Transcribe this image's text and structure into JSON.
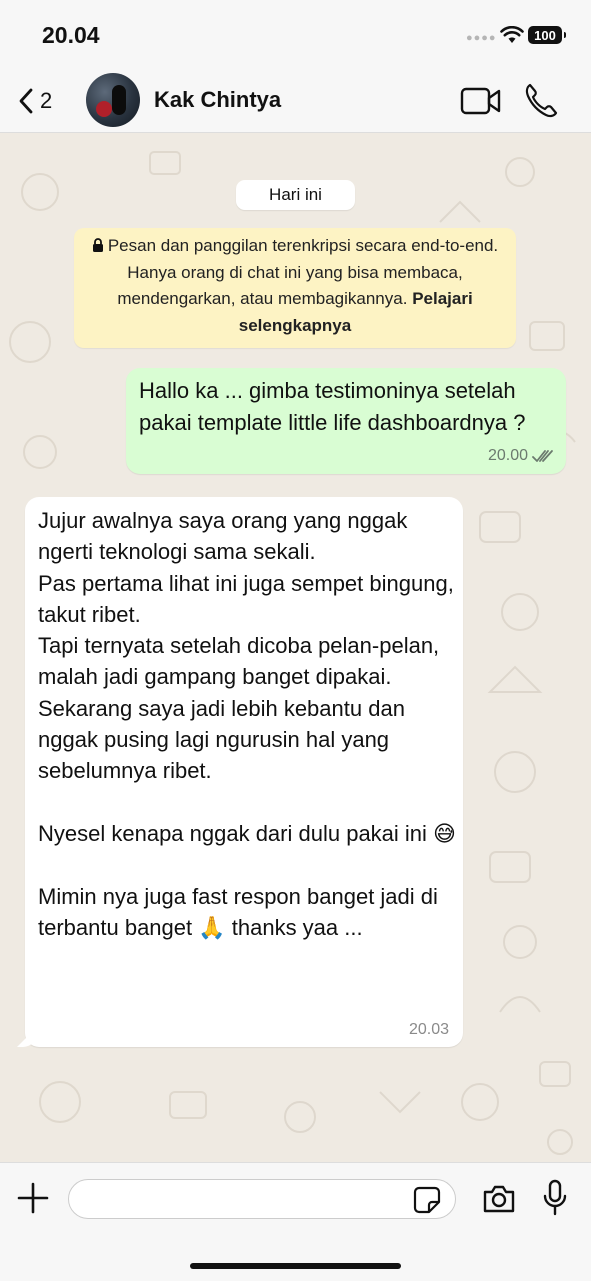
{
  "status_bar": {
    "time": "20.04",
    "battery": "100"
  },
  "header": {
    "back_count": "2",
    "contact_name": "Kak Chintya"
  },
  "chat": {
    "date_chip": "Hari ini",
    "encryption_notice": {
      "text": "Pesan dan panggilan terenkripsi secara end-to-end. Hanya orang di chat ini yang bisa membaca, mendengarkan, atau membagikannya.",
      "link": "Pelajari selengkapnya"
    },
    "messages": [
      {
        "direction": "outgoing",
        "text": "Hallo ka ... gimba testimoninya setelah pakai template little life dashboardnya ?",
        "time": "20.00",
        "status": "read"
      },
      {
        "direction": "incoming",
        "text": "Jujur awalnya saya orang yang nggak ngerti teknologi sama sekali.\nPas pertama lihat ini juga sempet bingung, takut ribet.\nTapi ternyata setelah dicoba pelan-pelan, malah jadi gampang banget dipakai.\nSekarang saya jadi lebih kebantu dan nggak pusing lagi ngurusin hal yang sebelumnya ribet.\n\nNyesel kenapa nggak dari dulu pakai ini 😅\n\nMimin nya juga fast respon banget jadi di terbantu banget 🙏 thanks yaa ...",
        "time": "20.03"
      }
    ]
  },
  "input_bar": {
    "placeholder": ""
  },
  "colors": {
    "chat_bg": "#efeae2",
    "outgoing_bubble": "#d9fdd3",
    "incoming_bubble": "#ffffff",
    "encryption_bg": "#fdf3c4",
    "read_tick": "#6b7a6e"
  }
}
